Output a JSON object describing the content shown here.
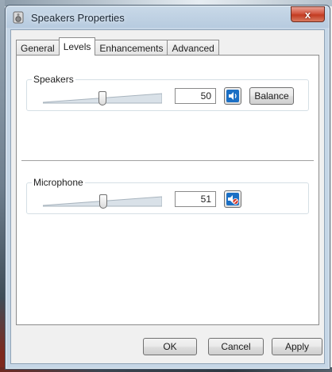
{
  "window": {
    "title": "Speakers Properties",
    "close_glyph": "x"
  },
  "tabs": [
    {
      "label": "General"
    },
    {
      "label": "Levels"
    },
    {
      "label": "Enhancements"
    },
    {
      "label": "Advanced"
    }
  ],
  "active_tab": "Levels",
  "speakers": {
    "label": "Speakers",
    "level": "50",
    "level_fraction": 0.5,
    "mute_icon": "speaker-icon",
    "balance_label": "Balance"
  },
  "microphone": {
    "label": "Microphone",
    "level": "51",
    "level_fraction": 0.51,
    "mute_icon": "speaker-muted-icon"
  },
  "footer": {
    "ok_label": "OK",
    "cancel_label": "Cancel",
    "apply_label": "Apply"
  },
  "colors": {
    "accent": "#1b6fc4",
    "mute_red": "#d43a2a"
  }
}
